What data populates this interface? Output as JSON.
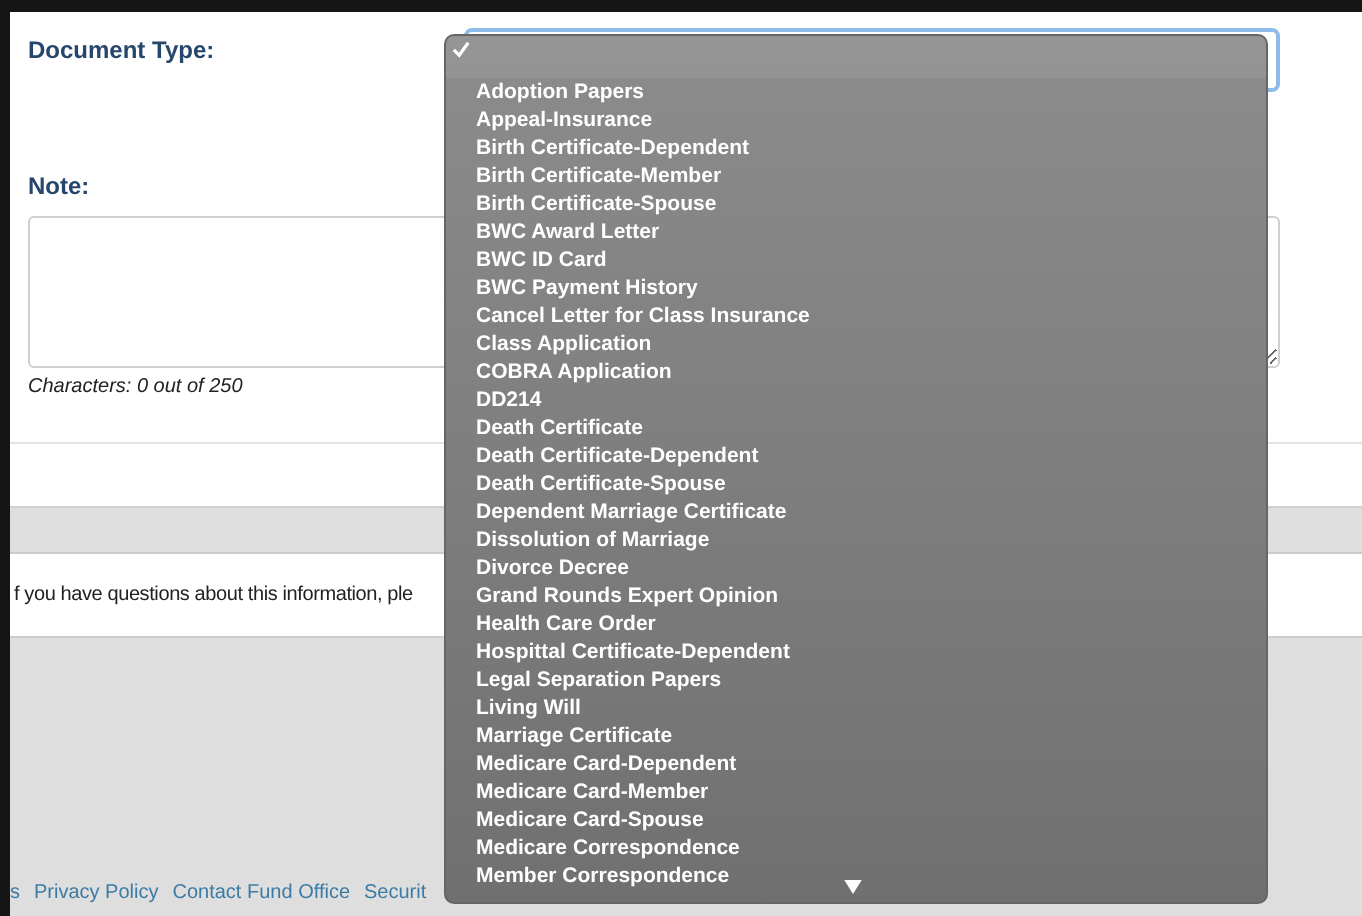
{
  "form": {
    "document_type": {
      "label": "Document Type:",
      "expanded": true,
      "options": [
        {
          "selected": true
        },
        {
          "label": "Adoption Papers",
          "selected": false
        },
        {
          "label": "Appeal-Insurance",
          "selected": false
        },
        {
          "label": "Birth Certificate-Dependent",
          "selected": false
        },
        {
          "label": "Birth Certificate-Member",
          "selected": false
        },
        {
          "label": "Birth Certificate-Spouse",
          "selected": false
        },
        {
          "label": "BWC Award Letter",
          "selected": false
        },
        {
          "label": "BWC ID Card",
          "selected": false
        },
        {
          "label": "BWC Payment History",
          "selected": false
        },
        {
          "label": "Cancel Letter for Class Insurance",
          "selected": false
        },
        {
          "label": "Class Application",
          "selected": false
        },
        {
          "label": "COBRA Application",
          "selected": false
        },
        {
          "label": "DD214",
          "selected": false
        },
        {
          "label": "Death Certificate",
          "selected": false
        },
        {
          "label": "Death Certificate-Dependent",
          "selected": false
        },
        {
          "label": "Death Certificate-Spouse",
          "selected": false
        },
        {
          "label": "Dependent Marriage Certificate",
          "selected": false
        },
        {
          "label": "Dissolution of Marriage",
          "selected": false
        },
        {
          "label": "Divorce Decree",
          "selected": false
        },
        {
          "label": "Grand Rounds Expert Opinion",
          "selected": false
        },
        {
          "label": "Health Care Order",
          "selected": false
        },
        {
          "label": "Hospittal Certificate-Dependent",
          "selected": false
        },
        {
          "label": "Legal Separation Papers",
          "selected": false
        },
        {
          "label": "Living Will",
          "selected": false
        },
        {
          "label": "Marriage Certificate",
          "selected": false
        },
        {
          "label": "Medicare Card-Dependent",
          "selected": false
        },
        {
          "label": "Medicare Card-Member",
          "selected": false
        },
        {
          "label": "Medicare Card-Spouse",
          "selected": false
        },
        {
          "label": "Medicare Correspondence",
          "selected": false
        },
        {
          "label": "Member Correspondence",
          "selected": false
        }
      ]
    },
    "note": {
      "label": "Note:",
      "counter": "Characters: 0 out of 250"
    }
  },
  "info": "f you have questions about this information, ple",
  "footer_links": [
    "s",
    "Privacy Policy",
    "Contact Fund Office",
    "Securit"
  ]
}
